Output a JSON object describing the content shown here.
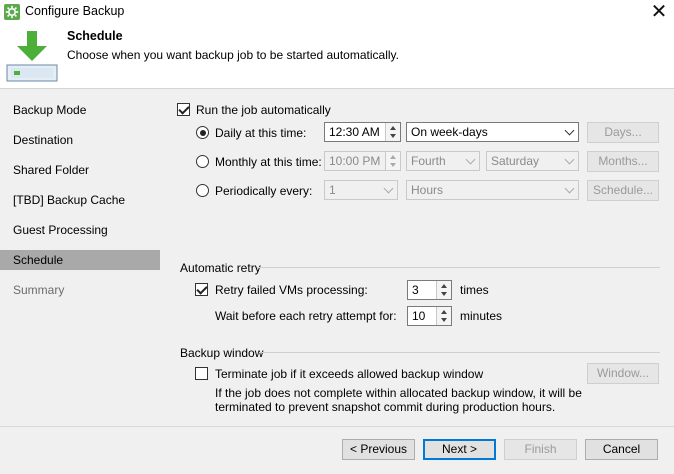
{
  "window": {
    "title": "Configure Backup",
    "close_glyph": "✕"
  },
  "header": {
    "title": "Schedule",
    "subtitle": "Choose when you want backup job to be started automatically."
  },
  "sidebar": {
    "items": [
      {
        "label": "Backup Mode"
      },
      {
        "label": "Destination"
      },
      {
        "label": "Shared Folder"
      },
      {
        "label": "[TBD] Backup Cache"
      },
      {
        "label": "Guest Processing"
      },
      {
        "label": "Schedule"
      },
      {
        "label": "Summary"
      }
    ]
  },
  "schedule": {
    "run_auto_label": "Run the job automatically",
    "run_auto_checked": true,
    "daily": {
      "label": "Daily at this time:",
      "time": "12:30 AM",
      "days_option": "On week-days",
      "button": "Days..."
    },
    "monthly": {
      "label": "Monthly at this time:",
      "time": "10:00 PM",
      "week": "Fourth",
      "weekday": "Saturday",
      "button": "Months..."
    },
    "periodic": {
      "label": "Periodically every:",
      "value": "1",
      "unit": "Hours",
      "button": "Schedule..."
    },
    "selected_mode": "daily"
  },
  "retry": {
    "section_title": "Automatic retry",
    "retry_label": "Retry failed VMs processing:",
    "retry_checked": true,
    "retry_count": "3",
    "retry_unit": "times",
    "wait_label": "Wait before each retry attempt for:",
    "wait_value": "10",
    "wait_unit": "minutes"
  },
  "window_section": {
    "section_title": "Backup window",
    "terminate_label": "Terminate job if it exceeds allowed backup window",
    "terminate_checked": false,
    "button": "Window...",
    "note_line1": "If the job does not complete within allocated backup window, it will be",
    "note_line2": "terminated to prevent snapshot commit during production hours."
  },
  "footer": {
    "previous": "< Previous",
    "next": "Next >",
    "finish": "Finish",
    "cancel": "Cancel"
  },
  "colors": {
    "brand_green": "#5aa94b",
    "selected_item": "#a9a9a9",
    "panel": "#f0f0f0",
    "primary_border": "#0078d7"
  }
}
